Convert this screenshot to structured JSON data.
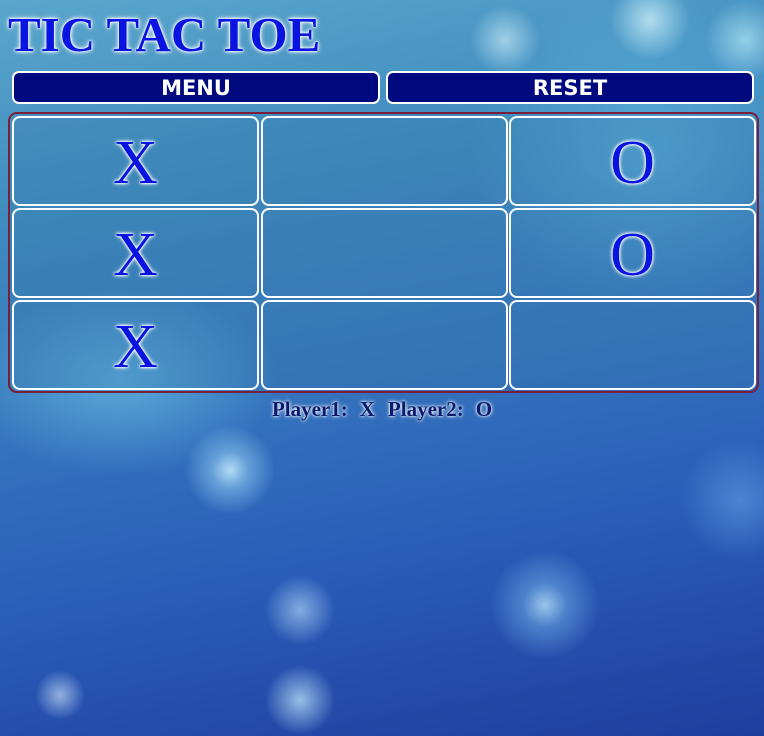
{
  "header": {
    "title": "TIC TAC TOE"
  },
  "toolbar": {
    "menu_label": "MENU",
    "reset_label": "RESET"
  },
  "board": {
    "cells": [
      [
        "X",
        "",
        "O"
      ],
      [
        "X",
        "",
        "O"
      ],
      [
        "X",
        "",
        ""
      ]
    ]
  },
  "status": {
    "player1_label": "Player1:",
    "player1_mark": "X",
    "player2_label": "Player2:",
    "player2_mark": "O"
  },
  "colors": {
    "title": "#0a14e0",
    "button_bg": "#000a7e",
    "board_border": "#7a1e3a",
    "cell_border": "#ffffff",
    "status_text": "#0a1a6e"
  }
}
